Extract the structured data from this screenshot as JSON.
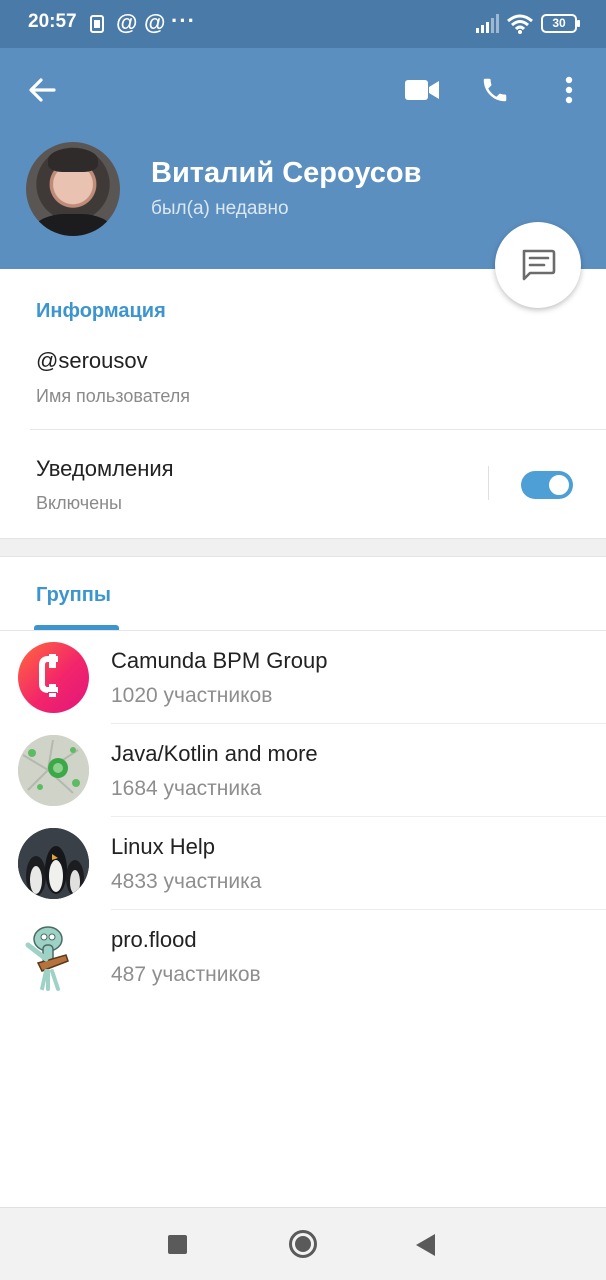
{
  "statusbar": {
    "time": "20:57",
    "icons": [
      "sim-icon",
      "at-icon",
      "at-icon",
      "more-dots-icon",
      "signal-icon",
      "wifi-icon"
    ],
    "battery": "30"
  },
  "header": {
    "name": "Виталий Сероусов",
    "status": "был(а) недавно",
    "icons": [
      "back-arrow-icon",
      "video-call-icon",
      "phone-icon",
      "more-vert-icon",
      "message-icon"
    ]
  },
  "info": {
    "section_title": "Информация",
    "username": "@serousov",
    "username_label": "Имя пользователя",
    "notifications_label": "Уведомления",
    "notifications_value": "Включены",
    "notifications_on": true
  },
  "groups": {
    "tab_label": "Группы",
    "items": [
      {
        "name": "Camunda BPM Group",
        "members": "1020 участников"
      },
      {
        "name": "Java/Kotlin and more",
        "members": "1684 участника"
      },
      {
        "name": "Linux Help",
        "members": "4833 участника"
      },
      {
        "name": "pro.flood",
        "members": "487 участников"
      }
    ]
  },
  "colors": {
    "header_bg": "#5b8fc0",
    "statusbar_bg": "#4a7aa8",
    "accent": "#3d95cf",
    "toggle": "#4d9fd6"
  },
  "navbar": {
    "icons": [
      "recents-square-icon",
      "home-circle-icon",
      "back-triangle-icon"
    ]
  }
}
